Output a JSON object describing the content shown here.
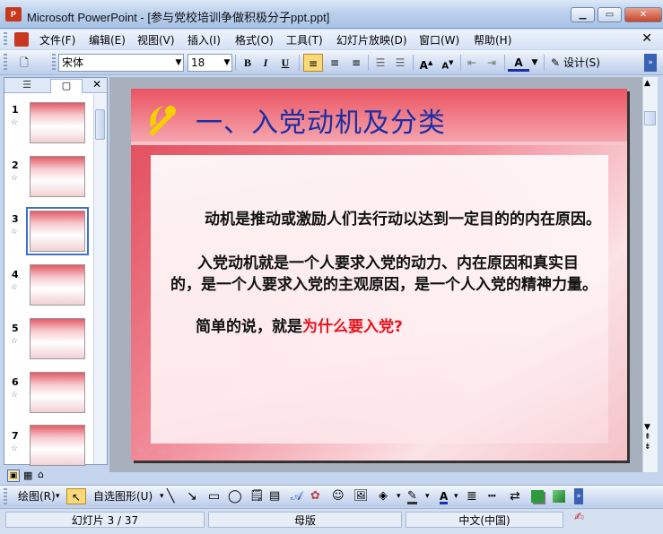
{
  "window": {
    "title": "Microsoft PowerPoint - [参与党校培训争做积极分子ppt.ppt]",
    "icon_label": "P"
  },
  "menu": {
    "items": [
      "文件(F)",
      "编辑(E)",
      "视图(V)",
      "插入(I)",
      "格式(O)",
      "工具(T)",
      "幻灯片放映(D)",
      "窗口(W)",
      "帮助(H)"
    ]
  },
  "toolbar": {
    "font_name": "宋体",
    "font_size": "18",
    "bold": "B",
    "italic": "I",
    "underline": "U",
    "design_label": "设计(S)"
  },
  "slides": {
    "numbers": [
      "1",
      "2",
      "3",
      "4",
      "5",
      "6",
      "7"
    ],
    "selected": "3"
  },
  "slide": {
    "title": "一、入党动机及分类",
    "para1": "动机是推动或激励人们去行动以达到一定目的的内在原因。",
    "para2": "入党动机就是一个人要求入党的动力、内在原因和真实目的，是一个人要求入党的主观原因，是一个人入党的精神力量。",
    "para3_prefix": "简单的说，就是",
    "para3_highlight": "为什么要入党?"
  },
  "drawing": {
    "draw_label": "绘图(R)",
    "autoshape_label": "自选图形(U)"
  },
  "status": {
    "slide_info": "幻灯片 3 / 37",
    "template": "母版",
    "language": "中文(中国)"
  },
  "colors": {
    "title_blue": "#1a2fa6",
    "highlight_red": "#e8141e",
    "selection_blue": "#3c6fcf"
  }
}
